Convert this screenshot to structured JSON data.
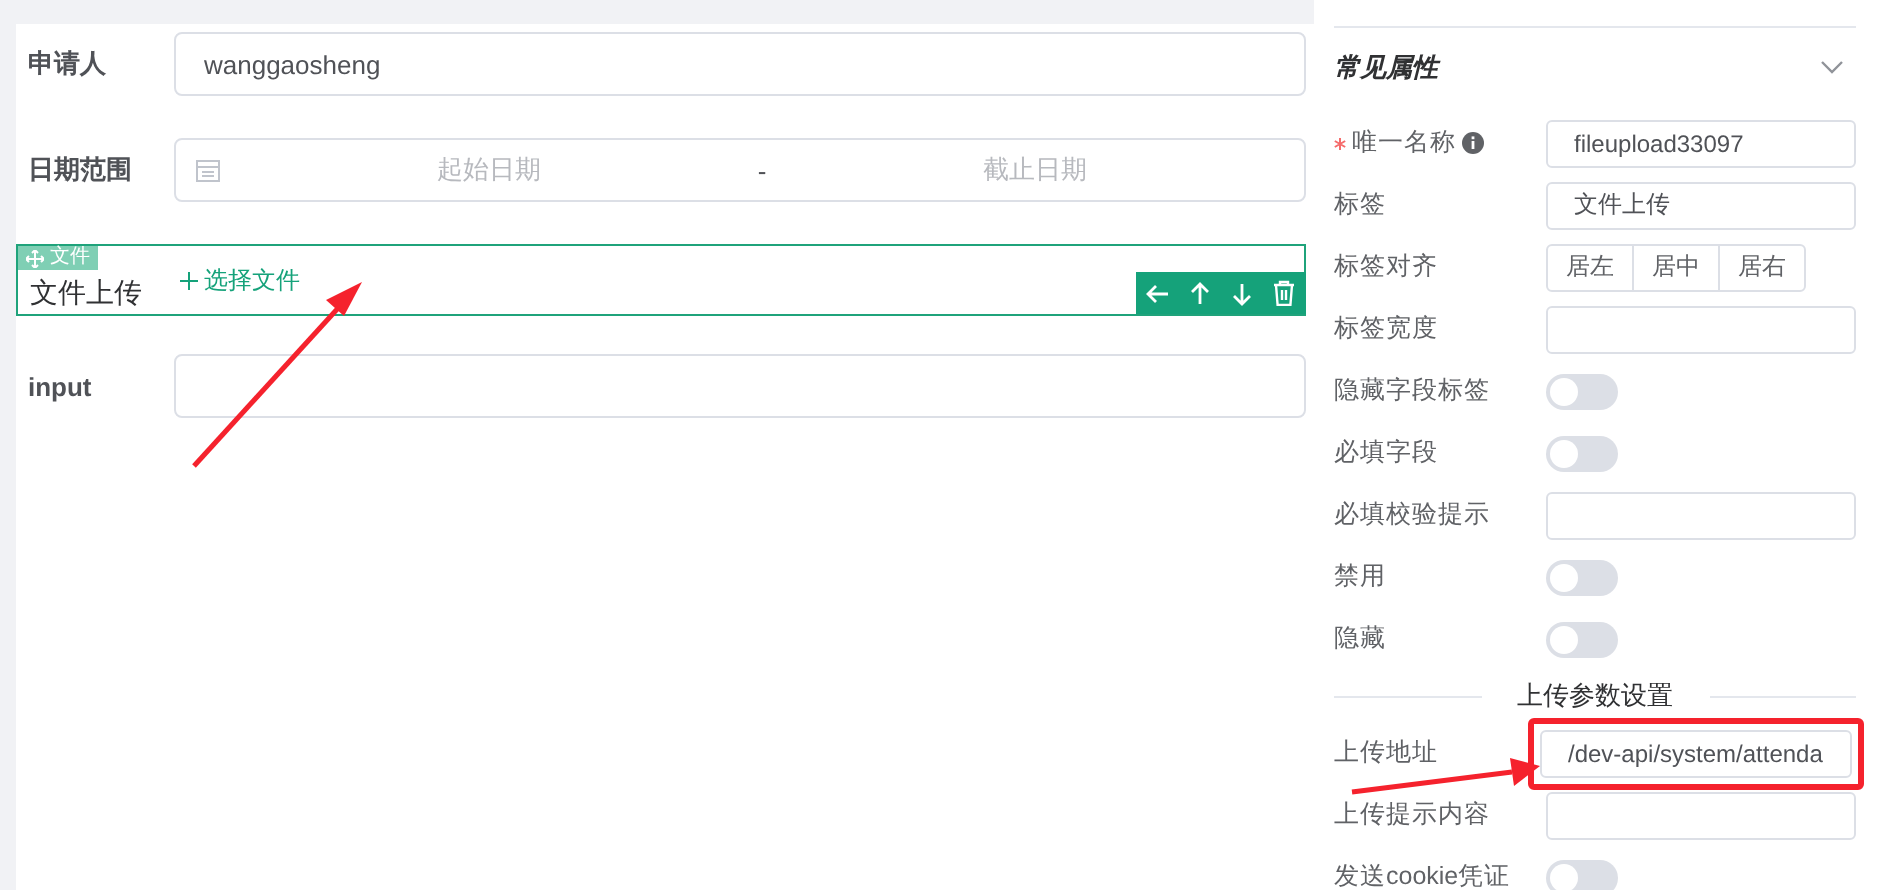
{
  "form": {
    "items": [
      {
        "kind": "input",
        "label": "申请人",
        "value": "wanggaosheng"
      },
      {
        "kind": "daterange",
        "label": "日期范围",
        "start_placeholder": "起始日期",
        "separator": "-",
        "end_placeholder": "截止日期"
      },
      {
        "kind": "upload",
        "label": "文件上传",
        "button": "选择文件",
        "selected": true,
        "badge": "文件"
      },
      {
        "kind": "input",
        "label": "input",
        "value": ""
      }
    ]
  },
  "properties": {
    "title": "常见属性",
    "expanded": true,
    "rows": [
      {
        "kind": "input",
        "label": "唯一名称",
        "required": true,
        "info": true,
        "value": "fileupload33097"
      },
      {
        "kind": "input",
        "label": "标签",
        "value": "文件上传"
      },
      {
        "kind": "radio-group",
        "label": "标签对齐",
        "options": [
          {
            "label": "居左",
            "selected": false
          },
          {
            "label": "居中",
            "selected": false
          },
          {
            "label": "居右",
            "selected": false
          }
        ]
      },
      {
        "kind": "input",
        "label": "标签宽度",
        "value": ""
      },
      {
        "kind": "switch",
        "label": "隐藏字段标签",
        "on": false
      },
      {
        "kind": "switch",
        "label": "必填字段",
        "on": false
      },
      {
        "kind": "input",
        "label": "必填校验提示",
        "value": ""
      },
      {
        "kind": "switch",
        "label": "禁用",
        "on": false
      },
      {
        "kind": "switch",
        "label": "隐藏",
        "on": false
      },
      {
        "kind": "divider",
        "label": "上传参数设置"
      },
      {
        "kind": "input",
        "label": "上传地址",
        "value": "/dev-api/system/attenda",
        "highlighted": true
      },
      {
        "kind": "input",
        "label": "上传提示内容",
        "value": ""
      },
      {
        "kind": "switch",
        "label": "发送cookie凭证",
        "on": false
      }
    ]
  }
}
